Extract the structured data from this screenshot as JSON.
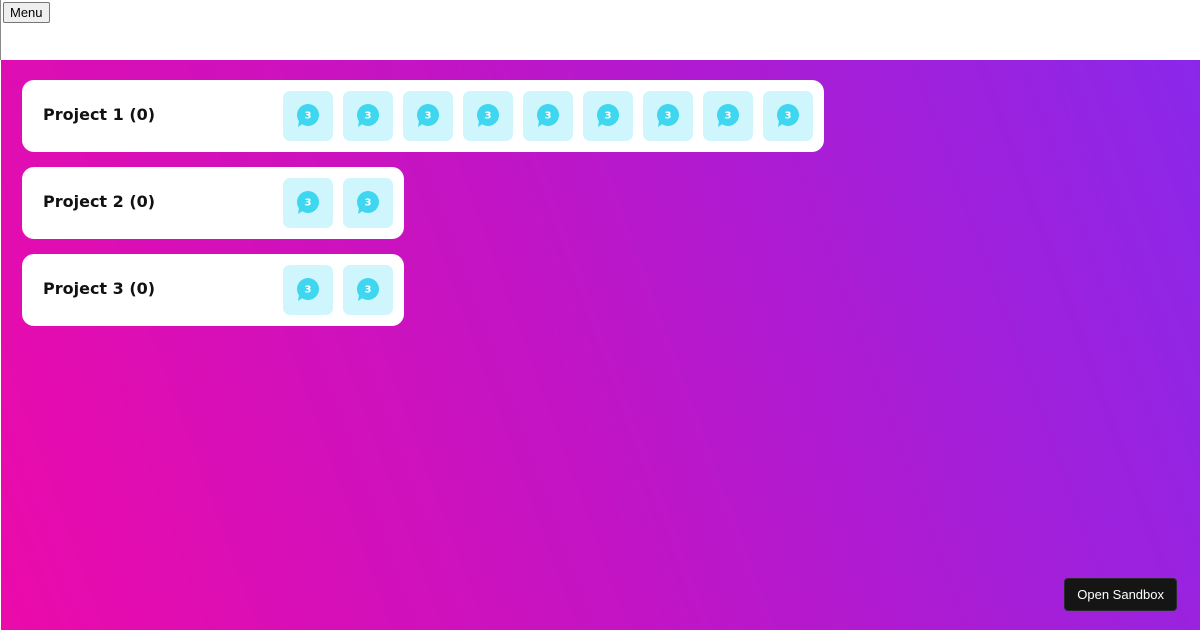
{
  "header": {
    "menu_label": "Menu"
  },
  "projects": [
    {
      "title": "Project 1 (0)",
      "tiles": [
        "3",
        "3",
        "3",
        "3",
        "3",
        "3",
        "3",
        "3",
        "3"
      ]
    },
    {
      "title": "Project 2 (0)",
      "tiles": [
        "3",
        "3"
      ]
    },
    {
      "title": "Project 3 (0)",
      "tiles": [
        "3",
        "3"
      ]
    }
  ],
  "sandbox_button": "Open Sandbox",
  "colors": {
    "gradient_start": "#ec0aaa",
    "gradient_end": "#8a28ea",
    "tile_background": "#cff6fd",
    "tile_icon": "#3fd6f0"
  },
  "icons": {
    "tile": "chat-bubble-icon"
  }
}
